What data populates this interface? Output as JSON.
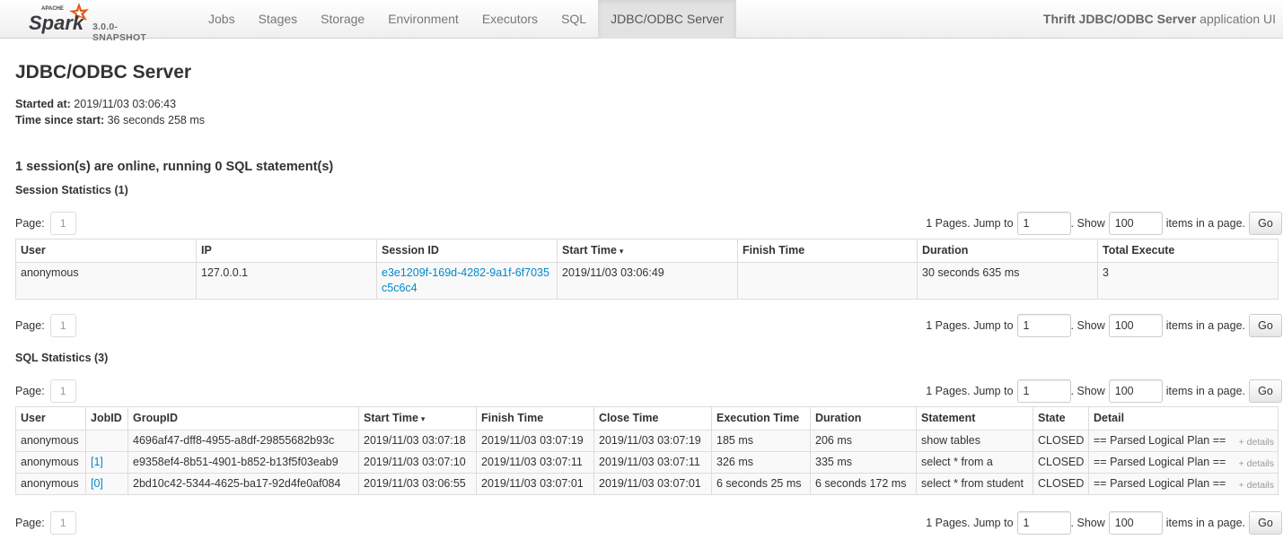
{
  "navbar": {
    "brand_top": "APACHE",
    "brand_name": "Spark",
    "version": "3.0.0-SNAPSHOT",
    "items": [
      {
        "label": "Jobs"
      },
      {
        "label": "Stages"
      },
      {
        "label": "Storage"
      },
      {
        "label": "Environment"
      },
      {
        "label": "Executors"
      },
      {
        "label": "SQL"
      },
      {
        "label": "JDBC/ODBC Server",
        "active": true
      }
    ],
    "app_title_bold": "Thrift JDBC/ODBC Server",
    "app_title_rest": " application UI"
  },
  "page": {
    "title": "JDBC/ODBC Server",
    "started_label": "Started at:",
    "started_value": " 2019/11/03 03:06:43",
    "elapsed_label": "Time since start:",
    "elapsed_value": " 36 seconds 258 ms",
    "summary": "1 session(s) are online, running 0 SQL statement(s)"
  },
  "pager": {
    "page_label": "Page:",
    "current_page": "1",
    "jump_text": "1 Pages. Jump to",
    "jump_value": "1",
    "show_text": ". Show",
    "show_value": "100",
    "items_text": "items in a page.",
    "go_label": "Go"
  },
  "session_stats": {
    "heading": "Session Statistics (1)",
    "sort_arrow": "▾",
    "headers": [
      "User",
      "IP",
      "Session ID",
      "Start Time",
      "Finish Time",
      "Duration",
      "Total Execute"
    ],
    "rows": [
      {
        "user": "anonymous",
        "ip": "127.0.0.1",
        "session_id": "e3e1209f-169d-4282-9a1f-6f7035c5c6c4",
        "start": "2019/11/03 03:06:49",
        "finish": "",
        "duration": "30 seconds 635 ms",
        "total": "3"
      }
    ]
  },
  "sql_stats": {
    "heading": "SQL Statistics (3)",
    "sort_arrow": "▾",
    "details_label": "+ details",
    "headers": [
      "User",
      "JobID",
      "GroupID",
      "Start Time",
      "Finish Time",
      "Close Time",
      "Execution Time",
      "Duration",
      "Statement",
      "State",
      "Detail"
    ],
    "rows": [
      {
        "user": "anonymous",
        "job": "",
        "group": "4696af47-dff8-4955-a8df-29855682b93c",
        "start": "2019/11/03 03:07:18",
        "finish": "2019/11/03 03:07:19",
        "close": "2019/11/03 03:07:19",
        "exec": "185 ms",
        "duration": "206 ms",
        "statement": "show tables",
        "state": "CLOSED",
        "detail": "== Parsed Logical Plan =="
      },
      {
        "user": "anonymous",
        "job": "[1]",
        "group": "e9358ef4-8b51-4901-b852-b13f5f03eab9",
        "start": "2019/11/03 03:07:10",
        "finish": "2019/11/03 03:07:11",
        "close": "2019/11/03 03:07:11",
        "exec": "326 ms",
        "duration": "335 ms",
        "statement": "select * from a",
        "state": "CLOSED",
        "detail": "== Parsed Logical Plan =="
      },
      {
        "user": "anonymous",
        "job": "[0]",
        "group": "2bd10c42-5344-4625-ba17-92d4fe0af084",
        "start": "2019/11/03 03:06:55",
        "finish": "2019/11/03 03:07:01",
        "close": "2019/11/03 03:07:01",
        "exec": "6 seconds 25 ms",
        "duration": "6 seconds 172 ms",
        "statement": "select * from student",
        "state": "CLOSED",
        "detail": "== Parsed Logical Plan =="
      }
    ]
  },
  "colors": {
    "link": "#0088cc",
    "navbar_active": "#e2e2e2",
    "spark_orange": "#e25a1c"
  }
}
